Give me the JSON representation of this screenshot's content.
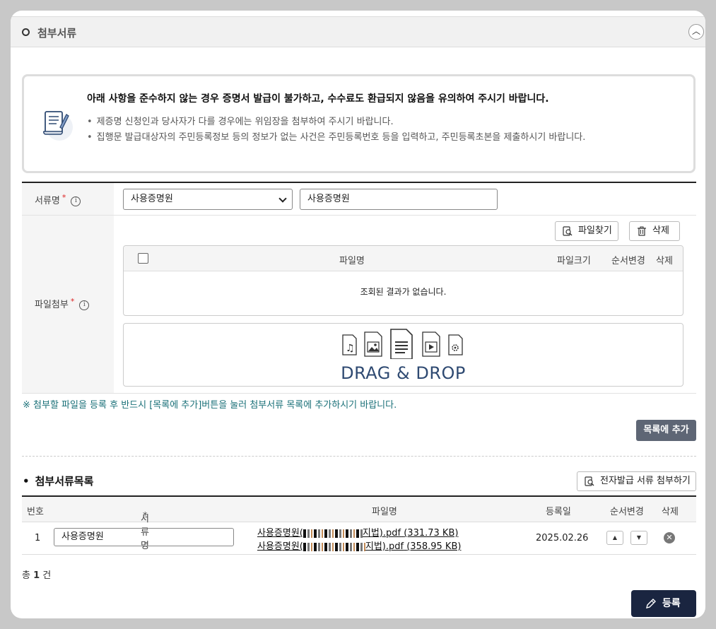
{
  "section": {
    "title": "첨부서류",
    "toggle_icon": "chevron-up-icon"
  },
  "notice": {
    "title": "아래 사항을 준수하지 않는 경우 증명서 발급이 불가하고, 수수료도 환급되지 않음을 유의하여 주시기 바랍니다.",
    "items": [
      "제증명 신청인과 당사자가 다를 경우에는 위임장을 첨부하여 주시기 바랍니다.",
      "집행문 발급대상자의 주민등록정보 등의 정보가 없는 사건은 주민등록번호 등을 입력하고, 주민등록초본을 제출하시기 바랍니다."
    ]
  },
  "form": {
    "doc_name_label": "서류명",
    "doc_select_value": "사용증명원",
    "doc_text_value": "사용증명원",
    "attach_label": "파일첨부",
    "required_mark": "*",
    "find_file_button": "파일찾기",
    "delete_button": "삭제",
    "file_table": {
      "headers": {
        "name": "파일명",
        "size": "파일크기",
        "order": "순서변경",
        "delete": "삭제"
      },
      "empty_message": "조회된 결과가 없습니다."
    },
    "drop_text": "DRAG & DROP"
  },
  "hint": "※ 첨부할 파일을 등록 후 반드시 [목록에 추가]버튼을 눌러 첨부서류 목록에 추가하시기 바랍니다.",
  "add_to_list_button": "목록에 추가",
  "list": {
    "title": "첨부서류목록",
    "e_doc_button": "전자발급 서류 첨부하기",
    "headers": {
      "no": "번호",
      "doc_name": "서류명",
      "file_name": "파일명",
      "date": "등록일",
      "order": "순서변경",
      "delete": "삭제"
    },
    "rows": [
      {
        "no": "1",
        "doc_name": "사용증명원",
        "files": [
          {
            "prefix": "사용증명원(",
            "suffix": "지법).pdf",
            "size": "(331.73 KB)"
          },
          {
            "prefix": "사용증명원(",
            "suffix": "지법).pdf",
            "size": "(358.95 KB)"
          }
        ],
        "date": "2025.02.26"
      }
    ],
    "total_prefix": "총",
    "total_count": "1",
    "total_suffix": "건"
  },
  "register_button": "등록",
  "colors": {
    "accent_dark": "#1a2540",
    "hint_teal": "#1a7078",
    "button_gray": "#5e6675",
    "drop_text": "#2f4a72"
  }
}
